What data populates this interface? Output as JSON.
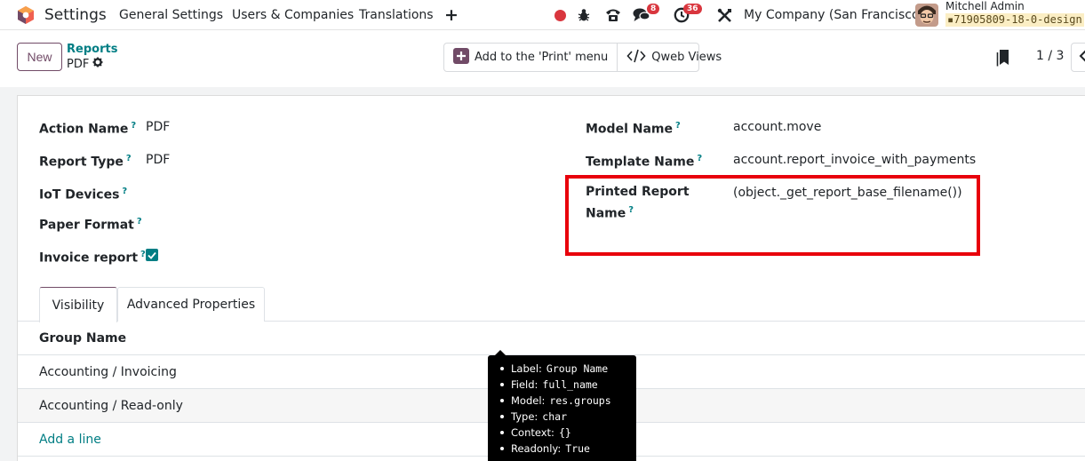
{
  "navbar": {
    "app_title": "Settings",
    "menu": [
      "General Settings",
      "Users & Companies",
      "Translations"
    ],
    "add_menu_icon": "plus-icon",
    "messages_count": "8",
    "activities_count": "36",
    "company": "My Company (San Francisco)",
    "user_name": "Mitchell Admin",
    "database": "71905809-18-0-design"
  },
  "control_panel": {
    "new_label": "New",
    "breadcrumb_parent": "Reports",
    "breadcrumb_current": "PDF",
    "add_print_menu_label": "Add to the 'Print' menu",
    "qweb_views_label": "Qweb Views",
    "pager": "1 / 3"
  },
  "form": {
    "help_mark": "?",
    "left": [
      {
        "label": "Action Name",
        "value": "PDF"
      },
      {
        "label": "Report Type",
        "value": "PDF"
      },
      {
        "label": "IoT Devices",
        "value": ""
      },
      {
        "label": "Paper Format",
        "value": ""
      },
      {
        "label": "Invoice report",
        "value": ""
      }
    ],
    "invoice_report_checked": true,
    "right": [
      {
        "label": "Model Name",
        "value": "account.move"
      },
      {
        "label": "Template Name",
        "value": "account.report_invoice_with_payments"
      },
      {
        "label_line1": "Printed Report",
        "label_line2": "Name",
        "value": "(object._get_report_base_filename())"
      }
    ]
  },
  "highlight_color": "#e8000b",
  "tabs": [
    {
      "label": "Visibility",
      "active": true
    },
    {
      "label": "Advanced Properties",
      "active": false
    }
  ],
  "groups_list": {
    "header": "Group Name",
    "rows": [
      "Accounting / Invoicing",
      "Accounting / Read-only"
    ],
    "add_line_label": "Add a line"
  },
  "tooltip": [
    {
      "key": "Label:",
      "value": "Group Name"
    },
    {
      "key": "Field:",
      "value": "full_name"
    },
    {
      "key": "Model:",
      "value": "res.groups"
    },
    {
      "key": "Type:",
      "value": "char"
    },
    {
      "key": "Context:",
      "value": "{}"
    },
    {
      "key": "Readonly:",
      "value": "True"
    }
  ],
  "colors": {
    "brand": "#714b67",
    "accent": "#017e84",
    "badge": "#d9363e"
  }
}
